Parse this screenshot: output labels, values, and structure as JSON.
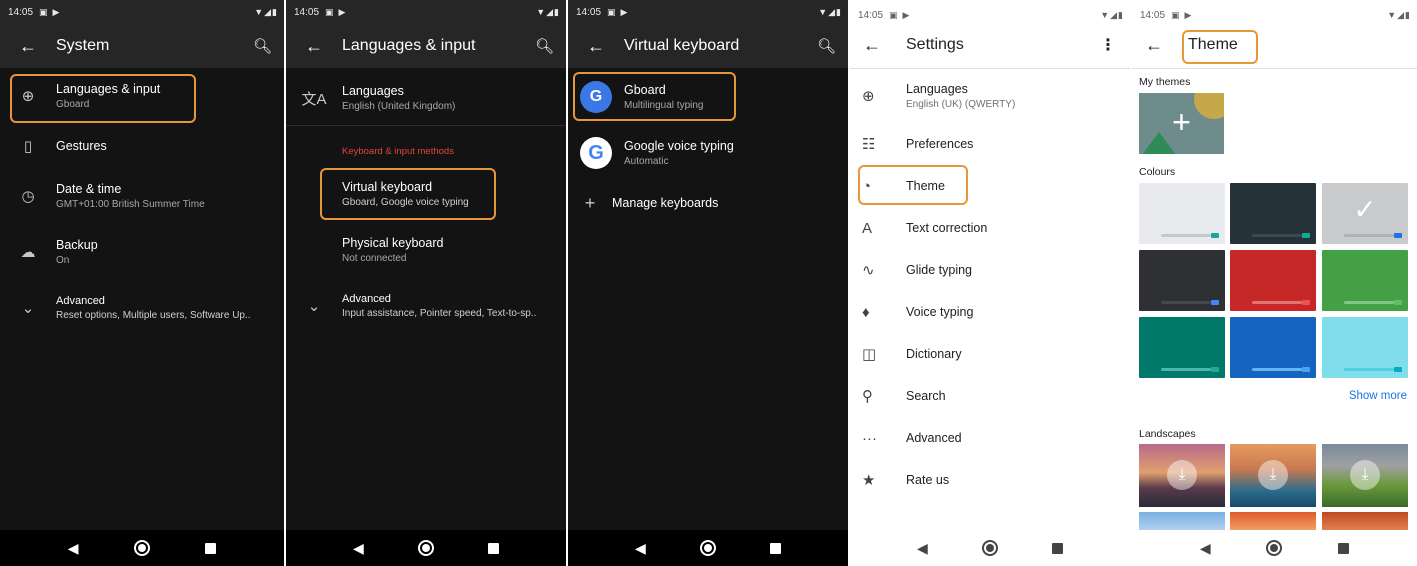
{
  "status": {
    "time": "14:05"
  },
  "panel1": {
    "title": "System",
    "items": [
      {
        "icon": "globe-icon",
        "title": "Languages & input",
        "subtitle": "Gboard"
      },
      {
        "icon": "gestures-icon",
        "title": "Gestures",
        "subtitle": ""
      },
      {
        "icon": "clock-icon",
        "title": "Date & time",
        "subtitle": "GMT+01:00 British Summer Time"
      },
      {
        "icon": "backup-icon",
        "title": "Backup",
        "subtitle": "On"
      },
      {
        "icon": "chevron-down-icon",
        "title": "Advanced",
        "subtitle": "Reset options, Multiple users, Software Up.."
      }
    ]
  },
  "panel2": {
    "title": "Languages & input",
    "languages": {
      "title": "Languages",
      "subtitle": "English (United Kingdom)"
    },
    "category": "Keyboard & input methods",
    "virtual_keyboard": {
      "title": "Virtual keyboard",
      "subtitle": "Gboard, Google voice typing"
    },
    "physical_keyboard": {
      "title": "Physical keyboard",
      "subtitle": "Not connected"
    },
    "advanced": {
      "title": "Advanced",
      "subtitle": "Input assistance, Pointer speed, Text-to-sp.."
    }
  },
  "panel3": {
    "title": "Virtual keyboard",
    "gboard": {
      "title": "Gboard",
      "subtitle": "Multilingual typing"
    },
    "voice": {
      "title": "Google voice typing",
      "subtitle": "Automatic"
    },
    "manage": "Manage keyboards"
  },
  "panel4": {
    "title": "Settings",
    "items": [
      {
        "icon": "globe-icon",
        "title": "Languages",
        "subtitle": "English (UK) (QWERTY)"
      },
      {
        "icon": "sliders-icon",
        "title": "Preferences",
        "subtitle": ""
      },
      {
        "icon": "palette-icon",
        "title": "Theme",
        "subtitle": ""
      },
      {
        "icon": "text-correction-icon",
        "title": "Text correction",
        "subtitle": ""
      },
      {
        "icon": "glide-icon",
        "title": "Glide typing",
        "subtitle": ""
      },
      {
        "icon": "microphone-icon",
        "title": "Voice typing",
        "subtitle": ""
      },
      {
        "icon": "book-icon",
        "title": "Dictionary",
        "subtitle": ""
      },
      {
        "icon": "search-icon",
        "title": "Search",
        "subtitle": ""
      },
      {
        "icon": "more-horizontal-icon",
        "title": "Advanced",
        "subtitle": ""
      },
      {
        "icon": "star-icon",
        "title": "Rate us",
        "subtitle": ""
      }
    ]
  },
  "panel5": {
    "title": "Theme",
    "my_themes": "My themes",
    "colours": "Colours",
    "show_more": "Show more",
    "landscapes": "Landscapes",
    "swatch_colors": [
      {
        "bg": "#e8eaed",
        "bar": "#c4c7cc",
        "dot": "#12a89a"
      },
      {
        "bg": "#253238",
        "bar": "#3a4a52",
        "dot": "#12a89a"
      },
      {
        "bg": "#c8cacc",
        "bar": "#aeb0b3",
        "dot": "#1a73e8"
      },
      {
        "bg": "#2e3034",
        "bar": "#45484d",
        "dot": "#4285f4"
      },
      {
        "bg": "#c62828",
        "bar": "#e57373",
        "dot": "#ef5350"
      },
      {
        "bg": "#43a047",
        "bar": "#81c784",
        "dot": "#66bb6a"
      },
      {
        "bg": "#00796b",
        "bar": "#4db6ac",
        "dot": "#26a69a"
      },
      {
        "bg": "#1565c0",
        "bar": "#64b5f6",
        "dot": "#42a5f5"
      },
      {
        "bg": "#80deea",
        "bar": "#4dd0e1",
        "dot": "#00acc1"
      }
    ]
  },
  "colors": {
    "highlight": "#e8963a",
    "accent_red": "#e3443a",
    "link_blue": "#1a73e8"
  }
}
